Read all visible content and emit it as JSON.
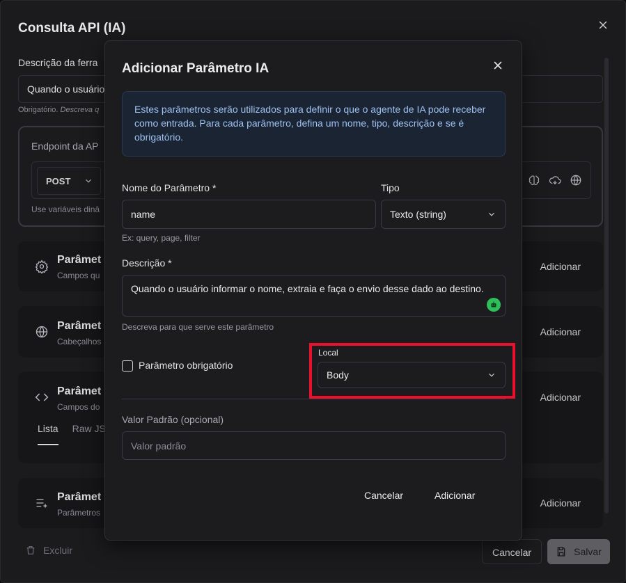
{
  "background": {
    "title": "Consulta API (IA)",
    "description_label": "Descrição da ferra",
    "description_value": "Quando o usuário",
    "description_hint_prefix": "Obrigatório.",
    "description_hint_rest": "Descreva q",
    "endpoint": {
      "title": "Endpoint da AP",
      "method": "POST",
      "hint": "Use variáveis dinâ"
    },
    "sections": [
      {
        "title": "Parâmet",
        "subtitle": "Campos qu",
        "action": "Adicionar",
        "icon": "gear-icon"
      },
      {
        "title": "Parâmet",
        "subtitle": "Cabeçalhos",
        "action": "Adicionar",
        "icon": "globe-icon"
      },
      {
        "title": "Parâmet",
        "subtitle": "Campos do",
        "action": "Adicionar",
        "icon": "code-icon",
        "tabs": [
          "Lista",
          "Raw JS"
        ]
      },
      {
        "title": "Parâmet",
        "subtitle": "Parâmetros",
        "action": "Adicionar",
        "icon": "list-plus-icon"
      }
    ],
    "footer": {
      "delete": "Excluir",
      "cancel": "Cancelar",
      "save": "Salvar"
    }
  },
  "modal": {
    "title": "Adicionar Parâmetro IA",
    "info": "Estes parâmetros serão utilizados para definir o que o agente de IA pode receber como entrada. Para cada parâmetro, defina um nome, tipo, descrição e se é obrigatório.",
    "name_label": "Nome do Parâmetro *",
    "name_value": "name",
    "name_hint": "Ex: query, page, filter",
    "type_label": "Tipo",
    "type_value": "Texto (string)",
    "desc_label": "Descrição *",
    "desc_value": "Quando o usuário informar o nome, extraia e faça o envio desse dado ao destino.",
    "desc_hint": "Descreva para que serve este parâmetro",
    "required_label": "Parâmetro obrigatório",
    "required_checked": false,
    "local_label": "Local",
    "local_value": "Body",
    "default_label": "Valor Padrão (opcional)",
    "default_placeholder": "Valor padrão",
    "cancel": "Cancelar",
    "submit": "Adicionar"
  },
  "colors": {
    "highlight": "#e8102c",
    "info_bg": "#1b2433",
    "info_text": "#9ec2f2",
    "ai_badge": "#2fbf5a"
  }
}
